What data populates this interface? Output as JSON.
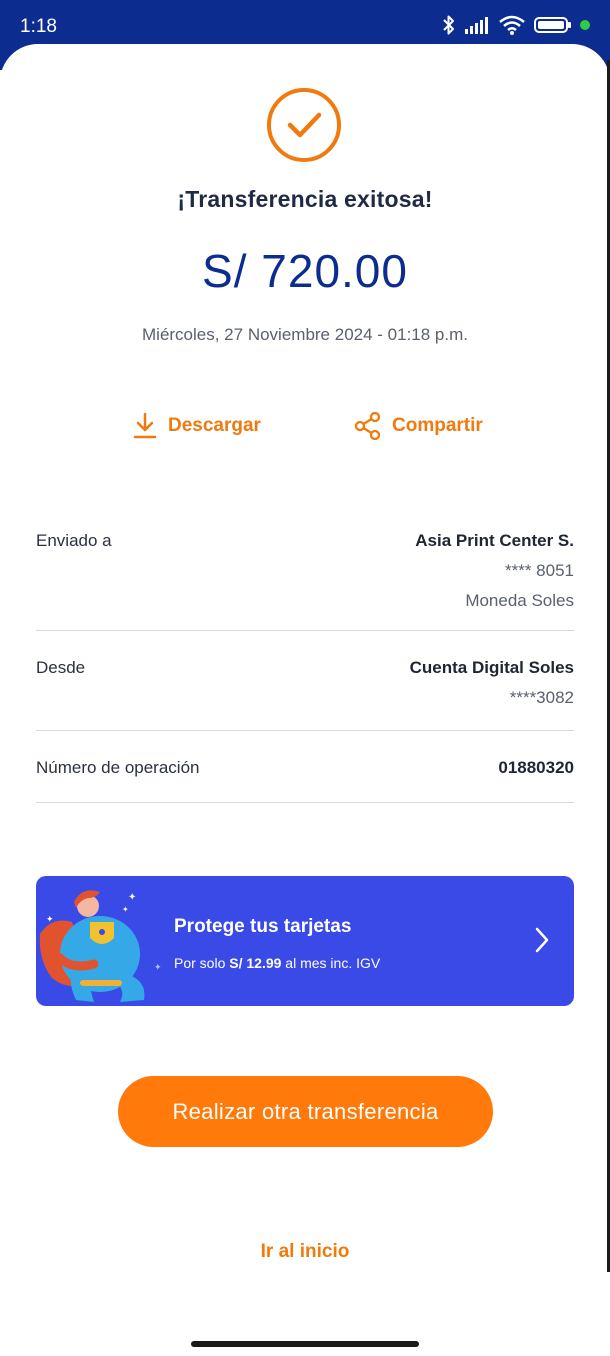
{
  "status_bar": {
    "time": "1:18",
    "icons": [
      "bluetooth-icon",
      "signal-icon",
      "wifi-icon",
      "battery-icon",
      "green-dot"
    ],
    "background": "#0c2d8f"
  },
  "receipt": {
    "title": "¡Transferencia exitosa!",
    "amount": "S/ 720.00",
    "datetime": "Miércoles, 27 Noviembre 2024 - 01:18 p.m."
  },
  "actions": {
    "download_label": "Descargar",
    "share_label": "Compartir"
  },
  "details": {
    "sent_to": {
      "label": "Enviado a",
      "name": "Asia Print Center S.",
      "account": "**** 8051",
      "currency": "Moneda Soles"
    },
    "from": {
      "label": "Desde",
      "account_name": "Cuenta Digital Soles",
      "account": "****3082"
    },
    "operation": {
      "label": "Número de operación",
      "value": "01880320"
    }
  },
  "banner": {
    "title": "Protege tus tarjetas",
    "sub_prefix": "Por solo",
    "sub_price": "S/ 12.99",
    "sub_suffix": "al mes inc. IGV",
    "color": "#3a4ae6"
  },
  "buttons": {
    "primary": "Realizar otra transferencia",
    "home": "Ir al inicio"
  },
  "colors": {
    "accent": "#ff7a0a",
    "brand": "#0c2d8f"
  }
}
